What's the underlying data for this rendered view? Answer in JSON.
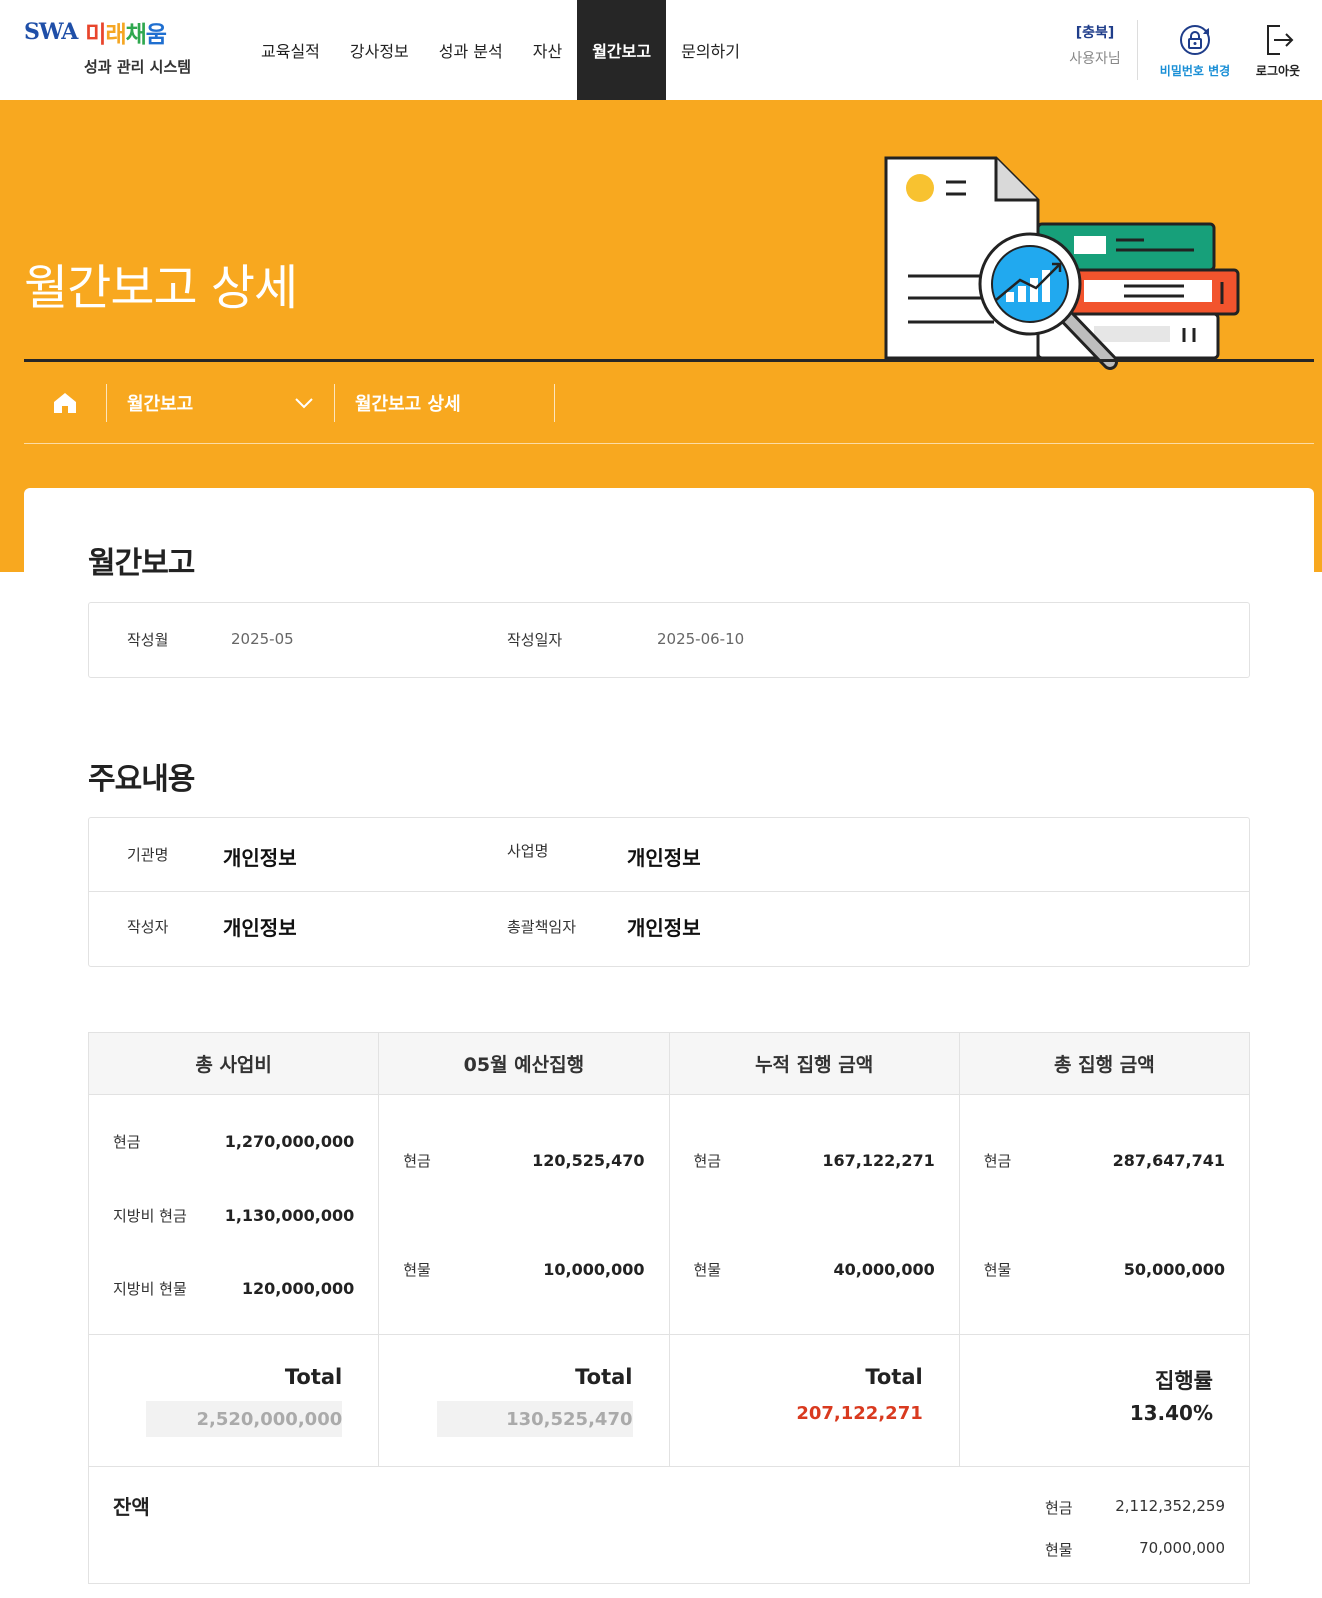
{
  "header": {
    "logo_latin": "SWA",
    "logo_brand": [
      "미",
      "래",
      "채",
      "움"
    ],
    "logo_subtitle": "성과 관리 시스템",
    "nav": [
      "교육실적",
      "강사정보",
      "성과 분석",
      "자산",
      "월간보고",
      "문의하기"
    ],
    "nav_active": "월간보고",
    "user_region": "[충북]",
    "user_name": "사용자님",
    "password_change": "비밀번호 변경",
    "logout": "로그아웃"
  },
  "banner": {
    "title": "월간보고 상세",
    "breadcrumb_section": "월간보고",
    "breadcrumb_current": "월간보고 상세",
    "color": "#f8a81f"
  },
  "report": {
    "title": "월간보고",
    "month_label": "작성월",
    "month_value": "2025-05",
    "date_label": "작성일자",
    "date_value": "2025-06-10"
  },
  "summary": {
    "title": "주요내용",
    "org_label": "기관명",
    "org_value": "개인정보",
    "project_label": "사업명",
    "project_value": "개인정보",
    "writer_label": "작성자",
    "writer_value": "개인정보",
    "manager_label": "총괄책임자",
    "manager_value": "개인정보"
  },
  "budget": {
    "headers": [
      "총 사업비",
      "05월 예산집행",
      "누적 집행 금액",
      "총 집행 금액"
    ],
    "total_budget": [
      {
        "label": "현금",
        "value": "1,270,000,000"
      },
      {
        "label": "지방비 현금",
        "value": "1,130,000,000"
      },
      {
        "label": "지방비 현물",
        "value": "120,000,000"
      }
    ],
    "monthly": [
      {
        "label": "현금",
        "value": "120,525,470"
      },
      {
        "label": "현물",
        "value": "10,000,000"
      }
    ],
    "cumulative": [
      {
        "label": "현금",
        "value": "167,122,271"
      },
      {
        "label": "현물",
        "value": "40,000,000"
      }
    ],
    "total_exec": [
      {
        "label": "현금",
        "value": "287,647,741"
      },
      {
        "label": "현물",
        "value": "50,000,000"
      }
    ],
    "total_label": "Total",
    "total_budget_sum": "2,520,000,000",
    "monthly_sum": "130,525,470",
    "cumulative_sum": "207,122,271",
    "rate_label": "집행률",
    "rate_value": "13.40%",
    "balance_title": "잔액",
    "balance": [
      {
        "label": "현금",
        "value": "2,112,352,259"
      },
      {
        "label": "현물",
        "value": "70,000,000"
      }
    ]
  }
}
